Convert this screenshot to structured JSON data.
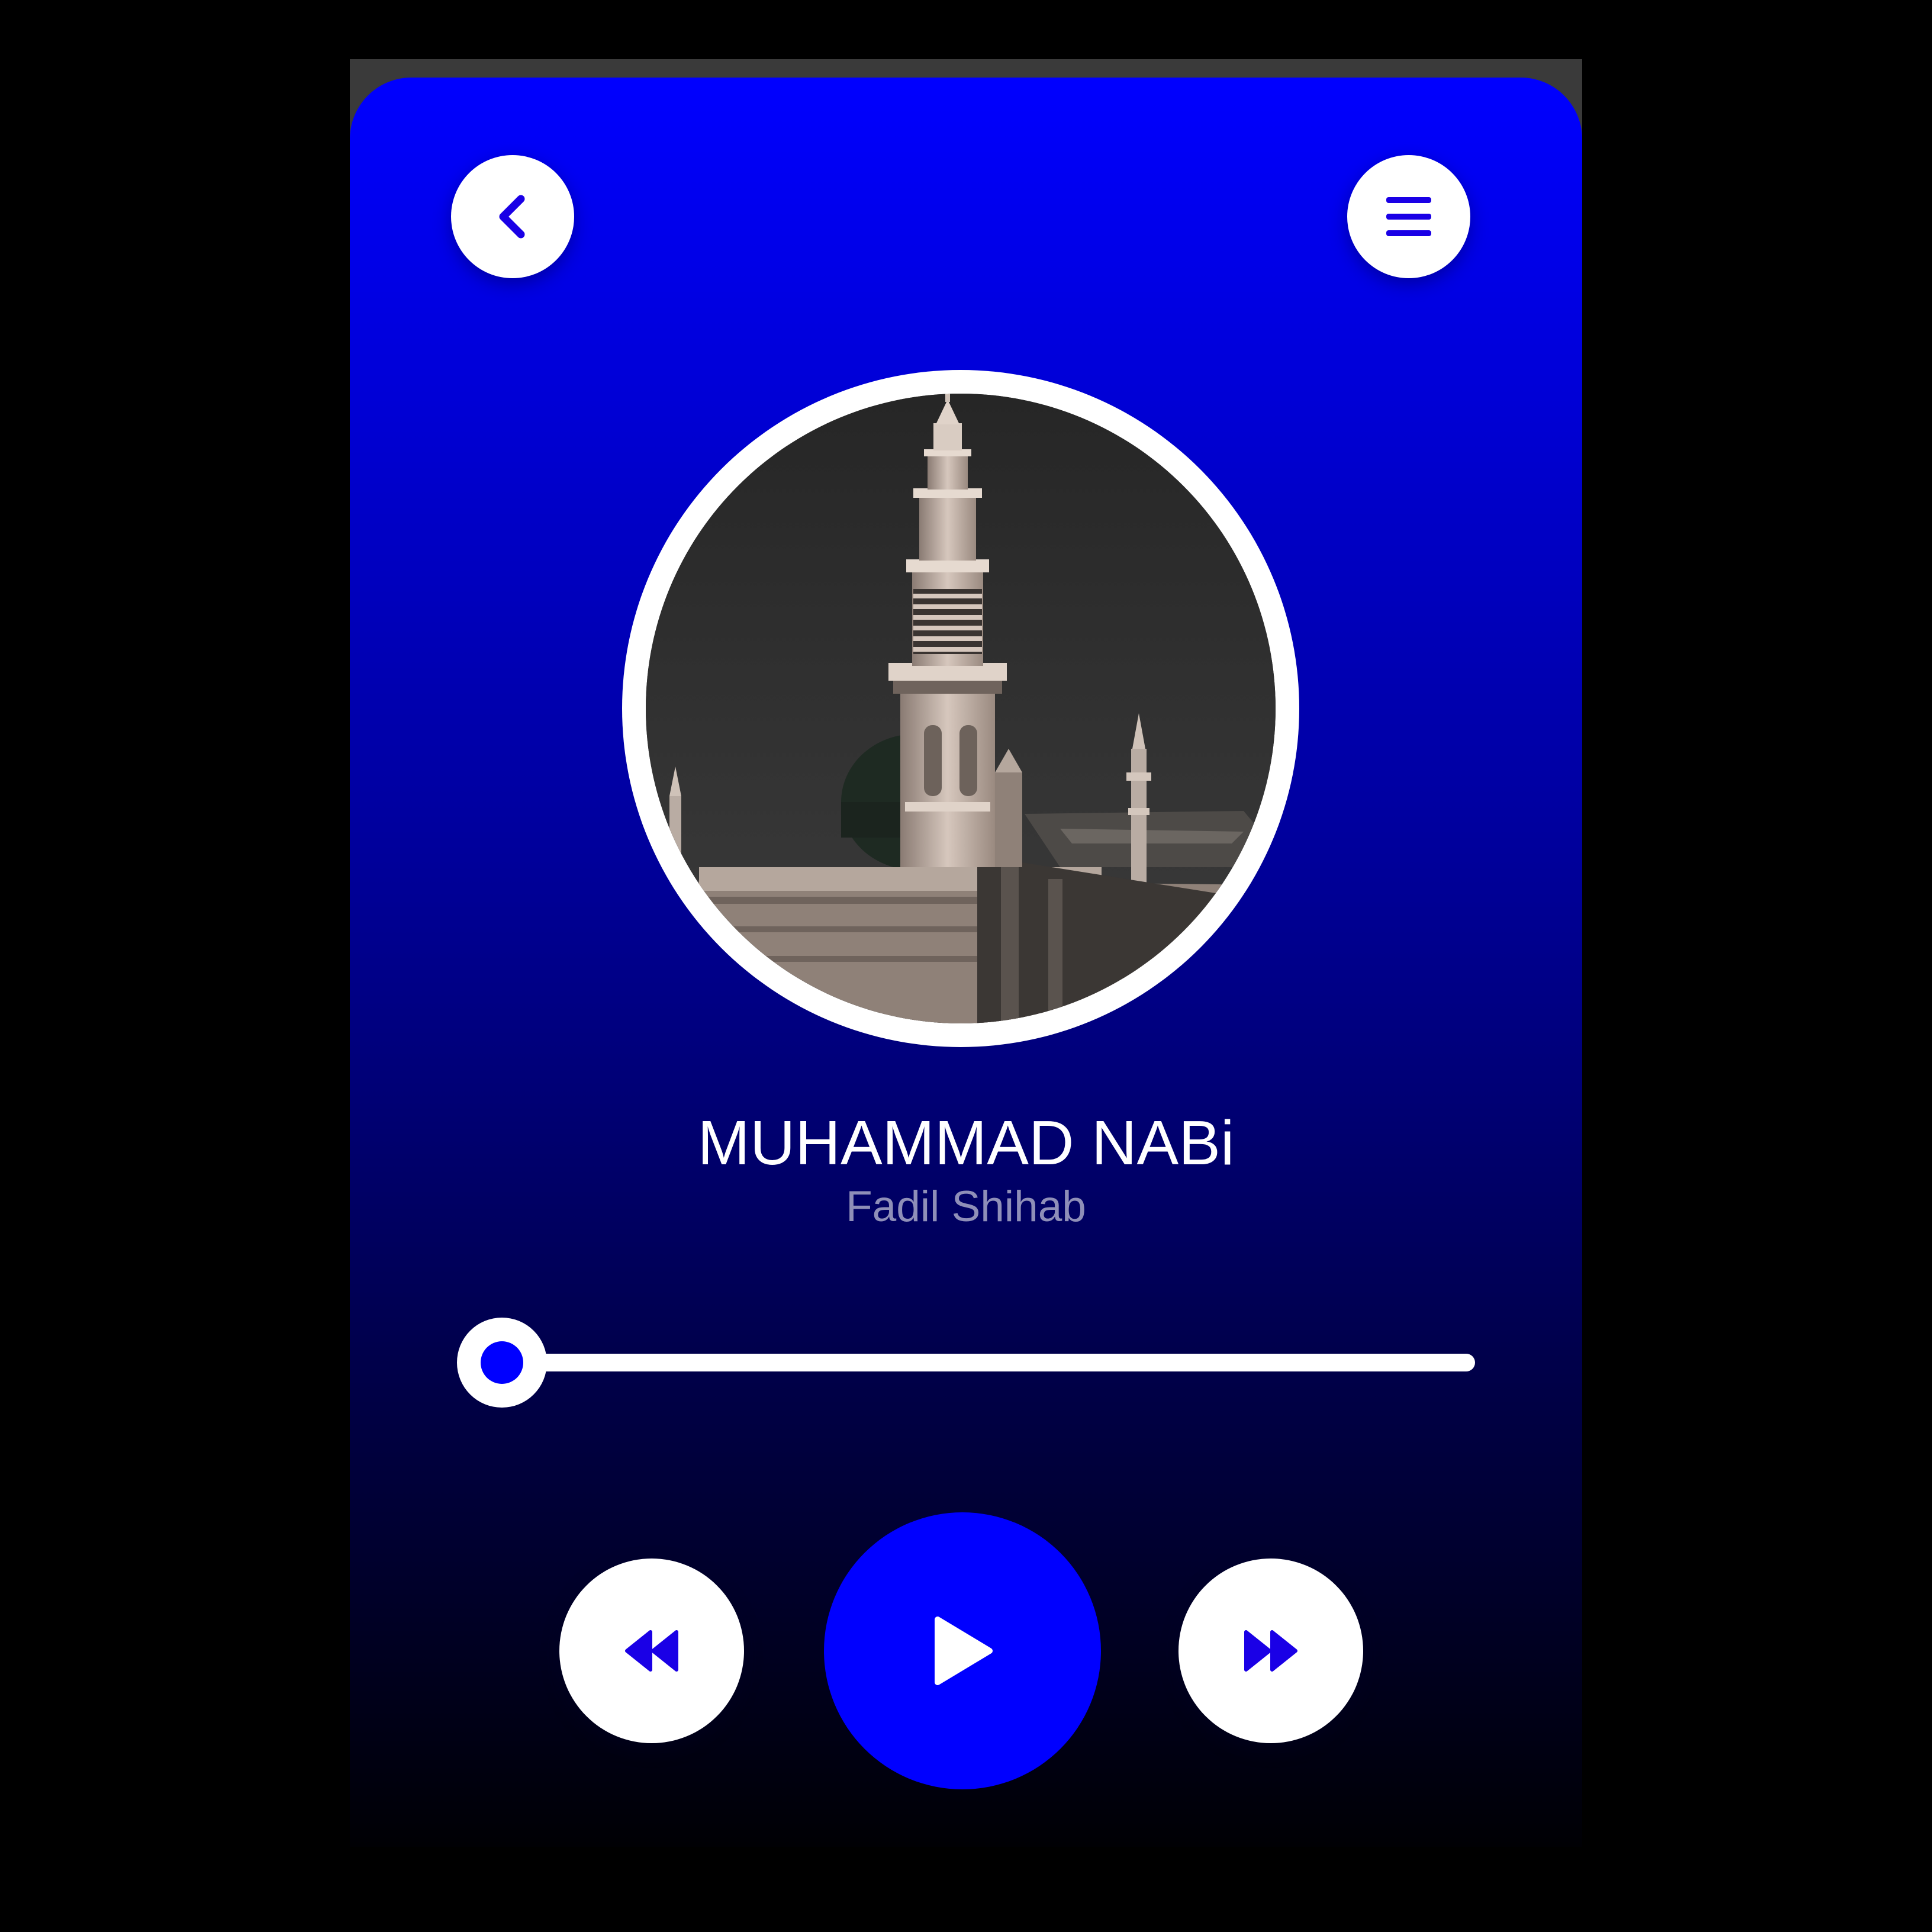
{
  "colors": {
    "accent": "#0000ff",
    "icon": "#1a00e6",
    "text_primary": "#ffffff",
    "text_secondary": "#8f8fb8"
  },
  "header": {
    "back_icon": "chevron-left-icon",
    "menu_icon": "hamburger-menu-icon"
  },
  "track": {
    "title": "MUHAMMAD NABi",
    "artist": "Fadil Shihab",
    "artwork": "mosque-minaret-photo"
  },
  "progress": {
    "fraction": 0.0
  },
  "controls": {
    "rewind_icon": "rewind-icon",
    "play_icon": "play-icon",
    "forward_icon": "fast-forward-icon"
  }
}
